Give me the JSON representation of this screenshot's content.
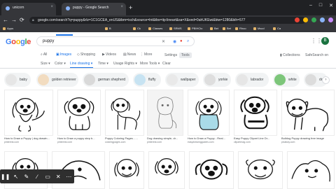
{
  "browser": {
    "tabs": [
      {
        "title": "unicorn",
        "active": false
      },
      {
        "title": "puppy - Google Search",
        "active": true
      }
    ],
    "new_tab": "+",
    "window_controls": [
      "–",
      "□",
      "✕"
    ],
    "nav": {
      "back": "←",
      "forward": "→",
      "reload": "⟳"
    },
    "url": "google.com/search?q=puppy&rlz=1C1GCEA_enUS&tbm=isch&source=lnt&tbs=itp:lineart&sa=X&ved=0ahUKEwi&biw=1280&bih=577",
    "bookmarks": [
      "Apps",
      "B",
      "Ck",
      "Classes",
      "SRMS",
      "PBIHCtc",
      "Bet",
      "Bet",
      "Rhoo",
      "Mscd",
      "Ca"
    ]
  },
  "google": {
    "logo": [
      "G",
      "o",
      "o",
      "g",
      "l",
      "e"
    ],
    "query": "puppy",
    "tabs": [
      {
        "label": "All",
        "icon": "search-icon"
      },
      {
        "label": "Images",
        "icon": "image-icon"
      },
      {
        "label": "Shopping",
        "icon": "tag-icon"
      },
      {
        "label": "Videos",
        "icon": "video-icon"
      },
      {
        "label": "News",
        "icon": "news-icon"
      },
      {
        "label": "More",
        "icon": "more-icon"
      }
    ],
    "settings": "Settings",
    "tools": "Tools",
    "collections": "Collections",
    "safesearch": "SafeSearch on",
    "avatar_letter": "B"
  },
  "filters": [
    {
      "label": "Size ▾",
      "selected": false
    },
    {
      "label": "Color ▾",
      "selected": false
    },
    {
      "label": "Line drawing ▾",
      "selected": true
    },
    {
      "label": "Time ▾",
      "selected": false
    },
    {
      "label": "Usage Rights ▾",
      "selected": false
    },
    {
      "label": "More Tools ▾",
      "selected": false
    },
    {
      "label": "Clear",
      "selected": false
    }
  ],
  "chips": [
    "baby",
    "golden retriever",
    "german shepherd",
    "fluffy",
    "wallpaper",
    "yorkie",
    "labrador",
    "white",
    "dog"
  ],
  "results": [
    {
      "caption": "How to Draw a Puppy | dog drawin...",
      "source": "pinterest.com"
    },
    {
      "caption": "How to Draw a puppy step b...",
      "source": "pinterest.com"
    },
    {
      "caption": "Puppy Coloring Pages - ...",
      "source": "coloringpages.com"
    },
    {
      "caption": "Dog drawing simple, dr...",
      "source": "pinterest.com"
    },
    {
      "caption": "How to Draw a Puppy - Real...",
      "source": "easydrawingguides.com"
    },
    {
      "caption": "Easy Puppy Clipart Line Dr...",
      "source": "clipartmag.com"
    },
    {
      "caption": "Bulldog Puppy drawing free image",
      "source": "pixabay.com"
    }
  ],
  "annotation_toolbar": [
    "❚❚",
    "↖",
    "✎",
    "∕",
    "▭",
    "✕",
    "⋯"
  ],
  "colors": {
    "chrome_dark": "#202124",
    "chrome_mid": "#35363a",
    "google_blue": "#1a73e8",
    "avatar_green": "#1a7340",
    "chip_bg": "#f1f3f4"
  }
}
